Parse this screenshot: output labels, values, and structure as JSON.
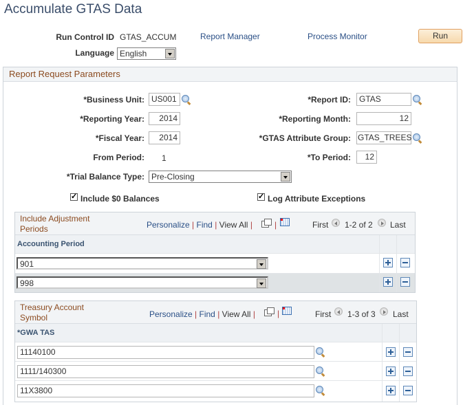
{
  "page": {
    "title": "Accumulate GTAS Data"
  },
  "header": {
    "run_control_label": "Run Control ID",
    "run_control_value": "GTAS_ACCUM",
    "report_manager": "Report Manager",
    "process_monitor": "Process Monitor",
    "run_button": "Run",
    "language_label": "Language",
    "language_value": "English"
  },
  "params": {
    "section_title": "Report Request Parameters",
    "business_unit_label": "*Business Unit:",
    "business_unit": "US001",
    "report_id_label": "*Report ID:",
    "report_id": "GTAS",
    "reporting_year_label": "*Reporting Year:",
    "reporting_year": "2014",
    "reporting_month_label": "*Reporting Month:",
    "reporting_month": "12",
    "fiscal_year_label": "*Fiscal Year:",
    "fiscal_year": "2014",
    "attr_group_label": "*GTAS Attribute Group:",
    "attr_group": "GTAS_TREES",
    "from_period_label": "From Period:",
    "from_period": "1",
    "to_period_label": "*To Period:",
    "to_period": "12",
    "trial_balance_label": "*Trial Balance Type:",
    "trial_balance": "Pre-Closing",
    "include_zero_label": "Include $0 Balances",
    "include_zero_checked": true,
    "log_exceptions_label": "Log Attribute Exceptions",
    "log_exceptions_checked": true
  },
  "adjustment_grid": {
    "title_line1": "Include Adjustment",
    "title_line2": "Periods",
    "personalize": "Personalize",
    "find": "Find",
    "view_all": "View All",
    "first": "First",
    "range": "1-2 of 2",
    "last": "Last",
    "column": "Accounting Period",
    "rows": [
      {
        "value": "901"
      },
      {
        "value": "998"
      }
    ]
  },
  "tas_grid": {
    "title_line1": "Treasury Account",
    "title_line2": "Symbol",
    "personalize": "Personalize",
    "find": "Find",
    "view_all": "View All",
    "first": "First",
    "range": "1-3 of 3",
    "last": "Last",
    "column": "*GWA TAS",
    "rows": [
      {
        "value": "11140100"
      },
      {
        "value": "1111/140300"
      },
      {
        "value": "11X3800"
      }
    ]
  },
  "separator": "|"
}
